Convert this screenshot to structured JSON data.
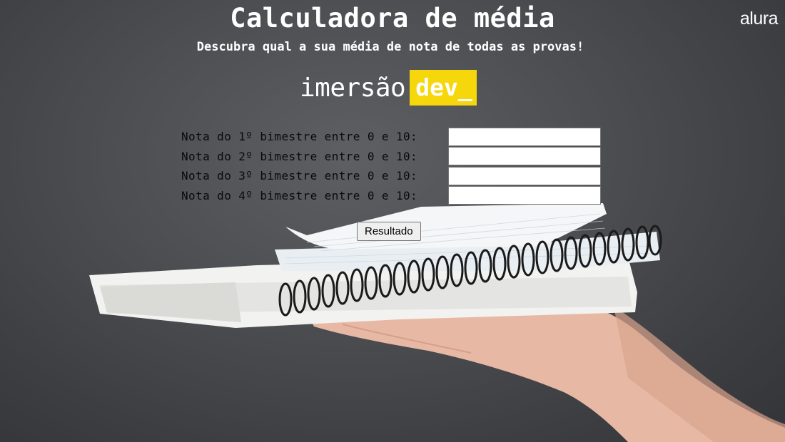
{
  "header": {
    "title": "Calculadora de média",
    "subtitle": "Descubra qual a sua média de nota de todas as provas!",
    "brand": "alura"
  },
  "banner": {
    "word": "imersão",
    "badge": "dev_",
    "badge_color": "#f6d70c"
  },
  "form": {
    "fields": [
      {
        "label": "Nota do 1º bimestre entre 0 e 10:",
        "value": ""
      },
      {
        "label": "Nota do 2º bimestre entre 0 e 10:",
        "value": ""
      },
      {
        "label": "Nota do 3º bimestre entre 0 e 10:",
        "value": ""
      },
      {
        "label": "Nota do 4º bimestre entre 0 e 10:",
        "value": ""
      }
    ],
    "submit_label": "Resultado"
  },
  "background": {
    "color": "#4d4e52"
  }
}
